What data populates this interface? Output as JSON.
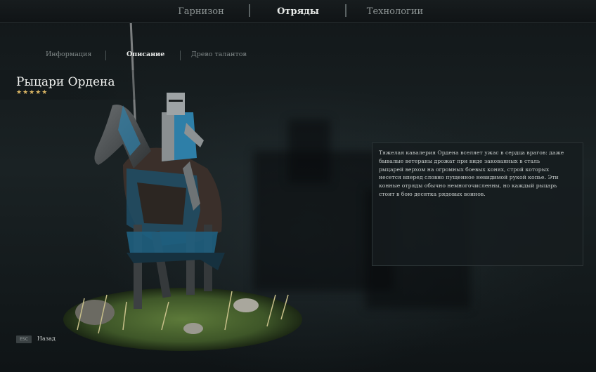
{
  "top_nav": {
    "tabs": [
      {
        "label": "Гарнизон"
      },
      {
        "label": "Отряды",
        "active": true
      },
      {
        "label": "Технологии"
      }
    ]
  },
  "sub_nav": {
    "tabs": [
      {
        "label": "Информация"
      },
      {
        "label": "Описание",
        "active": true
      },
      {
        "label": "Древо талантов"
      }
    ]
  },
  "unit": {
    "name": "Рыцари Ордена",
    "stars": 5,
    "star_glyphs": "★★★★★"
  },
  "description": {
    "lines": [
      "Тяжелая кавалерия Ордена вселяет ужас в сердца врагов: даже",
      "бывалые ветераны дрожат при виде закованных в сталь",
      "рыцарей верхом на огромных боевых конях, строй которых",
      "несется вперед словно пущенное невидимой рукой копье. Эти",
      "конные отряды обычно немногочисленны, но каждый рыцарь",
      "стоит в бою десятка рядовых воинов."
    ]
  },
  "footer": {
    "esc_key": "ESC",
    "back_label": "Назад"
  },
  "colors": {
    "accent_gold": "#d9b564",
    "armor_blue": "#2e7fa8"
  }
}
